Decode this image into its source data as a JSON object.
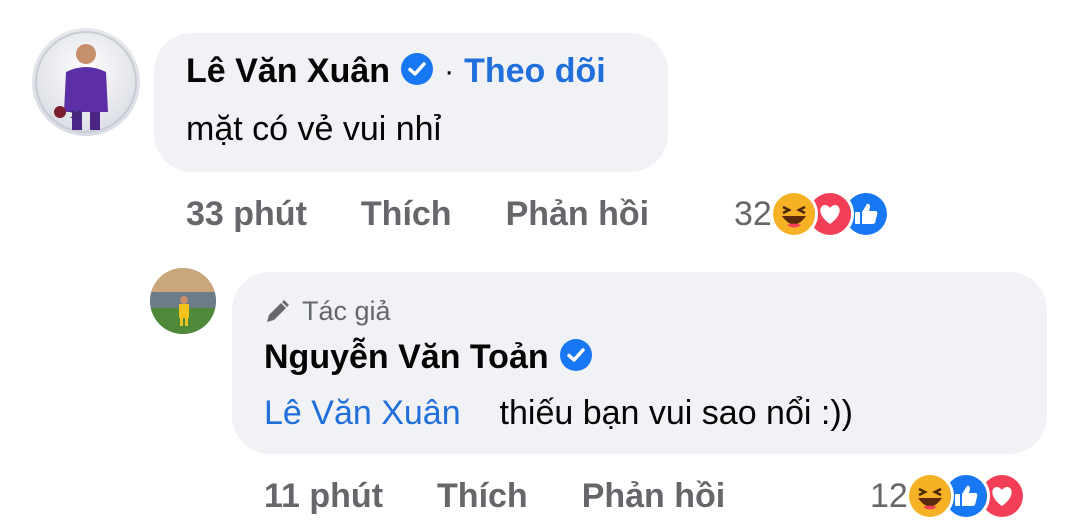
{
  "comment": {
    "author": "Lê Văn Xuân",
    "follow_label": "Theo dõi",
    "separator": "·",
    "text": "mặt có vẻ vui nhỉ",
    "time": "33 phút",
    "like_label": "Thích",
    "reply_label": "Phản hồi",
    "reaction_count": "32",
    "reactions": [
      "haha-icon",
      "love-icon",
      "like-icon"
    ]
  },
  "reply": {
    "author_tag": "Tác giả",
    "author": "Nguyễn Văn Toản",
    "mention": "Lê Văn Xuân",
    "text": "thiếu bạn vui sao nổi :))",
    "time": "11 phút",
    "like_label": "Thích",
    "reply_label": "Phản hồi",
    "reaction_count": "12",
    "reactions": [
      "haha-icon",
      "like-icon",
      "love-icon"
    ]
  },
  "colors": {
    "link_blue": "#216fdb",
    "bubble": "#f0f2f5",
    "meta_gray": "#65676b",
    "love": "#f33e58",
    "like": "#1877f2",
    "haha": "#f7b125"
  }
}
